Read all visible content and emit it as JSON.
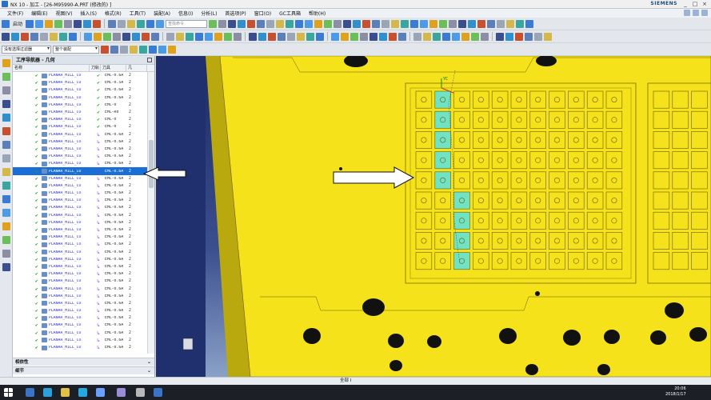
{
  "window": {
    "title": "NX 10 - 加工 - [26-M95990-A.PRT  (修改的) ]",
    "brand": "SIEMENS",
    "controls": [
      "_",
      "□",
      "×"
    ]
  },
  "menu": {
    "items": [
      "文件(F)",
      "编辑(E)",
      "视图(V)",
      "插入(S)",
      "格式(R)",
      "工具(T)",
      "装配(A)",
      "信息(I)",
      "分析(L)",
      "首选项(P)",
      "窗口(O)",
      "GC工具箱",
      "帮助(H)"
    ]
  },
  "toolbar": {
    "start_label": "启动",
    "search_placeholder": "查找命令",
    "selection_filter": "没有选择过滤器",
    "assembly_scope": "整个装配"
  },
  "navigator": {
    "title": "工序导航器 - 几何",
    "columns": [
      "名称",
      "刀轨",
      "刀具",
      "几"
    ],
    "selected_index": 13,
    "rows": [
      {
        "name": "PLANAR_MILL_CO",
        "path": "ok",
        "tool": "EMC-0.6A",
        "geom": "2"
      },
      {
        "name": "PLANAR_MILL_CO",
        "path": "ok",
        "tool": "EMC-0.5A",
        "geom": "2"
      },
      {
        "name": "PLANAR_MILL_CO",
        "path": "ok",
        "tool": "EMC-0.6A",
        "geom": "2"
      },
      {
        "name": "PLANAR_MILL_CO",
        "path": "ok",
        "tool": "EMC-0.6A",
        "geom": "2"
      },
      {
        "name": "PLANAR_MILL_CO",
        "path": "ok",
        "tool": "EMC-0",
        "geom": "2"
      },
      {
        "name": "PLANAR_MILL_CO",
        "path": "ok",
        "tool": "EMC-R0",
        "geom": "2"
      },
      {
        "name": "PLANAR_MILL_CO",
        "path": "ok",
        "tool": "EMC-0",
        "geom": "2"
      },
      {
        "name": "PLANAR_MILL_CO",
        "path": "ok",
        "tool": "EMC-0",
        "geom": "2"
      },
      {
        "name": "PLANAR_MILL_CO",
        "path": "reg",
        "tool": "EMC-0.6A",
        "geom": "2"
      },
      {
        "name": "PLANAR_MILL_CO",
        "path": "reg",
        "tool": "EMC-0.6A",
        "geom": "2"
      },
      {
        "name": "PLANAR_MILL_CO",
        "path": "reg",
        "tool": "EMC-0.6A",
        "geom": "2"
      },
      {
        "name": "PLANAR_MILL_CO",
        "path": "reg",
        "tool": "EMC-0.6A",
        "geom": "2"
      },
      {
        "name": "PLANAR_MILL_CO",
        "path": "reg",
        "tool": "EMC-0.6A",
        "geom": "2"
      },
      {
        "name": "PLANAR_MILL_CO",
        "path": "reg",
        "tool": "EMC-0.6A",
        "geom": "2"
      },
      {
        "name": "PLANAR_MILL_CO",
        "path": "reg",
        "tool": "EMC-0.6A",
        "geom": "2"
      },
      {
        "name": "PLANAR_MILL_CO",
        "path": "reg",
        "tool": "EMC-0.6A",
        "geom": "2"
      },
      {
        "name": "PLANAR_MILL_CO",
        "path": "reg",
        "tool": "EMC-0.6A",
        "geom": "2"
      },
      {
        "name": "PLANAR_MILL_CO",
        "path": "reg",
        "tool": "EMC-0.6A",
        "geom": "2"
      },
      {
        "name": "PLANAR_MILL_CO",
        "path": "reg",
        "tool": "EMC-0.6A",
        "geom": "2"
      },
      {
        "name": "PLANAR_MILL_CO",
        "path": "reg",
        "tool": "EMC-0.6A",
        "geom": "2"
      },
      {
        "name": "PLANAR_MILL_CO",
        "path": "reg",
        "tool": "EMC-0.6A",
        "geom": "2"
      },
      {
        "name": "PLANAR_MILL_CO",
        "path": "reg",
        "tool": "EMC-0.6A",
        "geom": "2"
      },
      {
        "name": "PLANAR_MILL_CO",
        "path": "reg",
        "tool": "EMC-0.6A",
        "geom": "2"
      },
      {
        "name": "PLANAR_MILL_CO",
        "path": "reg",
        "tool": "EMC-0.6A",
        "geom": "2"
      },
      {
        "name": "PLANAR_MILL_CO",
        "path": "reg",
        "tool": "EMC-0.6A",
        "geom": "2"
      },
      {
        "name": "PLANAR_MILL_CO",
        "path": "reg",
        "tool": "EMC-0.6A",
        "geom": "2"
      },
      {
        "name": "PLANAR_MILL_CO",
        "path": "reg",
        "tool": "EMC-0.6A",
        "geom": "2"
      },
      {
        "name": "PLANAR_MILL_CO",
        "path": "reg",
        "tool": "EMC-0.6A",
        "geom": "2"
      },
      {
        "name": "PLANAR_MILL_CO",
        "path": "reg",
        "tool": "EMC-0.6A",
        "geom": "2"
      },
      {
        "name": "PLANAR_MILL_CO",
        "path": "reg",
        "tool": "EMC-0.6A",
        "geom": "2"
      },
      {
        "name": "PLANAR_MILL_CO",
        "path": "reg",
        "tool": "EMC-0.6A",
        "geom": "2"
      },
      {
        "name": "PLANAR_MILL_CO",
        "path": "reg",
        "tool": "EMC-0.6A",
        "geom": "2"
      },
      {
        "name": "PLANAR_MILL_CO",
        "path": "reg",
        "tool": "EMC-0.6A",
        "geom": "2"
      },
      {
        "name": "PLANAR_MILL_CO",
        "path": "reg",
        "tool": "EMC-0.6A",
        "geom": "2"
      },
      {
        "name": "PLANAR_MILL_CO",
        "path": "reg",
        "tool": "EMC-0.6A",
        "geom": "2"
      },
      {
        "name": "PLANAR_MILL_CO",
        "path": "reg",
        "tool": "EMC-0.6A",
        "geom": "2"
      },
      {
        "name": "PLANAR_MILL_CO",
        "path": "reg",
        "tool": "EMC-0.6A",
        "geom": "2"
      },
      {
        "name": "PLANAR_MILL_CO",
        "path": "reg",
        "tool": "EMC-0.6A",
        "geom": "2"
      }
    ],
    "footer_dependency": "相依性",
    "footer_details": "细节"
  },
  "viewport": {
    "background_top": "#1d2a66",
    "part_color": "#f5e21a",
    "highlight_color": "#6fe3c4",
    "axis_label": "YC"
  },
  "status": {
    "text": "全部 Ⅰ"
  },
  "taskbar": {
    "time": "20:06",
    "date": "2018/1/17"
  },
  "colors": {
    "accent": "#1a6fd6",
    "check": "#17a21b",
    "regen": "#8a2be2"
  }
}
